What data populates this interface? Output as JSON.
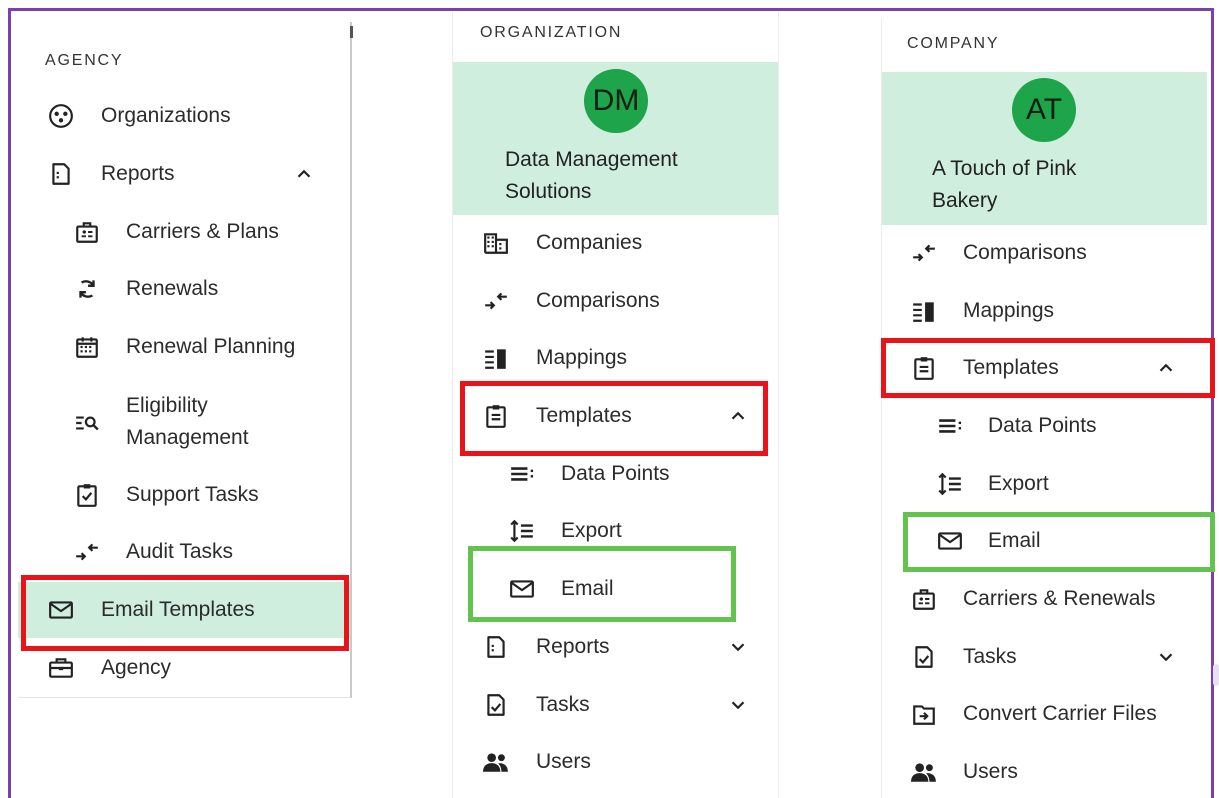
{
  "panels": {
    "agency": {
      "section_label": "AGENCY",
      "items": [
        {
          "label": "Organizations",
          "icon": "organizations-icon"
        },
        {
          "label": "Reports",
          "icon": "reports-icon",
          "chevron": "up"
        },
        {
          "label": "Carriers & Plans",
          "icon": "carriers-plans-icon"
        },
        {
          "label": "Renewals",
          "icon": "renewals-icon"
        },
        {
          "label": "Renewal Planning",
          "icon": "calendar-icon"
        },
        {
          "label_line1": "Eligibility",
          "label_line2": "Management",
          "icon": "eligibility-icon"
        },
        {
          "label": "Support Tasks",
          "icon": "clipboard-check-icon"
        },
        {
          "label": "Audit Tasks",
          "icon": "compare-arrows-icon"
        },
        {
          "label": "Email Templates",
          "icon": "email-icon",
          "active": true
        },
        {
          "label": "Agency",
          "icon": "briefcase-icon"
        }
      ]
    },
    "organization": {
      "section_label": "ORGANIZATION",
      "avatar_initials": "DM",
      "name_line1": "Data Management",
      "name_line2": "Solutions",
      "items": [
        {
          "label": "Companies",
          "icon": "building-icon"
        },
        {
          "label": "Comparisons",
          "icon": "compare-arrows-icon"
        },
        {
          "label": "Mappings",
          "icon": "mappings-icon"
        },
        {
          "label": "Templates",
          "icon": "clipboard-icon",
          "chevron": "up"
        },
        {
          "label": "Data Points",
          "icon": "data-points-icon"
        },
        {
          "label": "Export",
          "icon": "export-icon"
        },
        {
          "label": "Email",
          "icon": "email-icon"
        },
        {
          "label": "Reports",
          "icon": "reports-icon",
          "chevron": "down"
        },
        {
          "label": "Tasks",
          "icon": "tasks-icon",
          "chevron": "down"
        },
        {
          "label": "Users",
          "icon": "users-icon"
        }
      ]
    },
    "company": {
      "section_label": "COMPANY",
      "avatar_initials": "AT",
      "name_line1": "A Touch of Pink",
      "name_line2": "Bakery",
      "items": [
        {
          "label": "Comparisons",
          "icon": "compare-arrows-icon"
        },
        {
          "label": "Mappings",
          "icon": "mappings-icon"
        },
        {
          "label": "Templates",
          "icon": "clipboard-icon",
          "chevron": "up"
        },
        {
          "label": "Data Points",
          "icon": "data-points-icon"
        },
        {
          "label": "Export",
          "icon": "export-icon"
        },
        {
          "label": "Email",
          "icon": "email-icon"
        },
        {
          "label": "Carriers & Renewals",
          "icon": "carriers-plans-icon"
        },
        {
          "label": "Tasks",
          "icon": "tasks-icon",
          "chevron": "down"
        },
        {
          "label": "Convert Carrier Files",
          "icon": "convert-file-icon"
        },
        {
          "label": "Users",
          "icon": "users-icon"
        }
      ]
    }
  },
  "colors": {
    "highlight_red": "#e8141a",
    "highlight_green": "#64c24e",
    "active_background": "#cfeedd",
    "avatar_green": "#1ea44a",
    "frame_purple": "#7a3fb0"
  }
}
